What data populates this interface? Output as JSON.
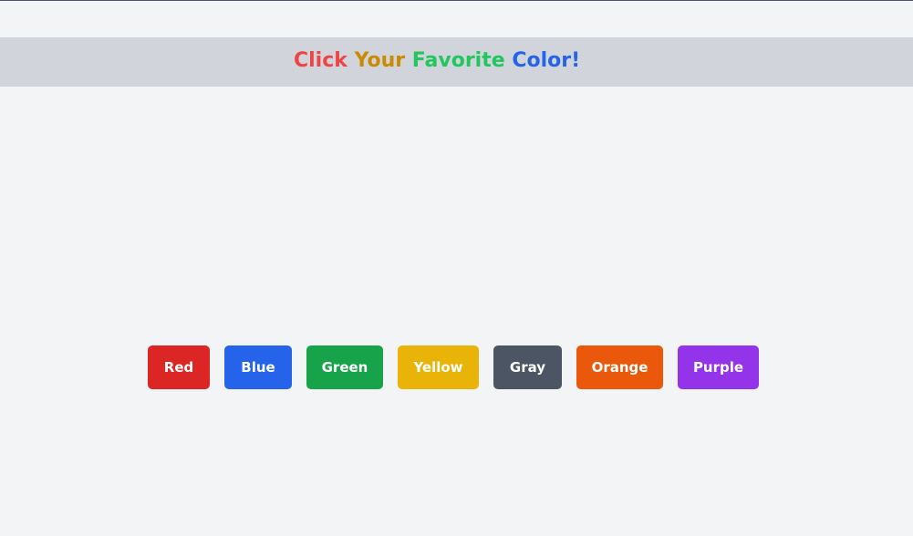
{
  "header": {
    "title_words": [
      {
        "text": "Click",
        "color": "#ef4444"
      },
      {
        "text": "Your",
        "color": "#ca8a04"
      },
      {
        "text": "Favorite",
        "color": "#22c55e"
      },
      {
        "text": "Color!",
        "color": "#2563eb"
      }
    ]
  },
  "buttons": [
    {
      "label": "Red",
      "color": "#dc2626"
    },
    {
      "label": "Blue",
      "color": "#2563eb"
    },
    {
      "label": "Green",
      "color": "#16a34a"
    },
    {
      "label": "Yellow",
      "color": "#eab308"
    },
    {
      "label": "Gray",
      "color": "#4b5563"
    },
    {
      "label": "Orange",
      "color": "#ea580c"
    },
    {
      "label": "Purple",
      "color": "#9333ea"
    }
  ]
}
